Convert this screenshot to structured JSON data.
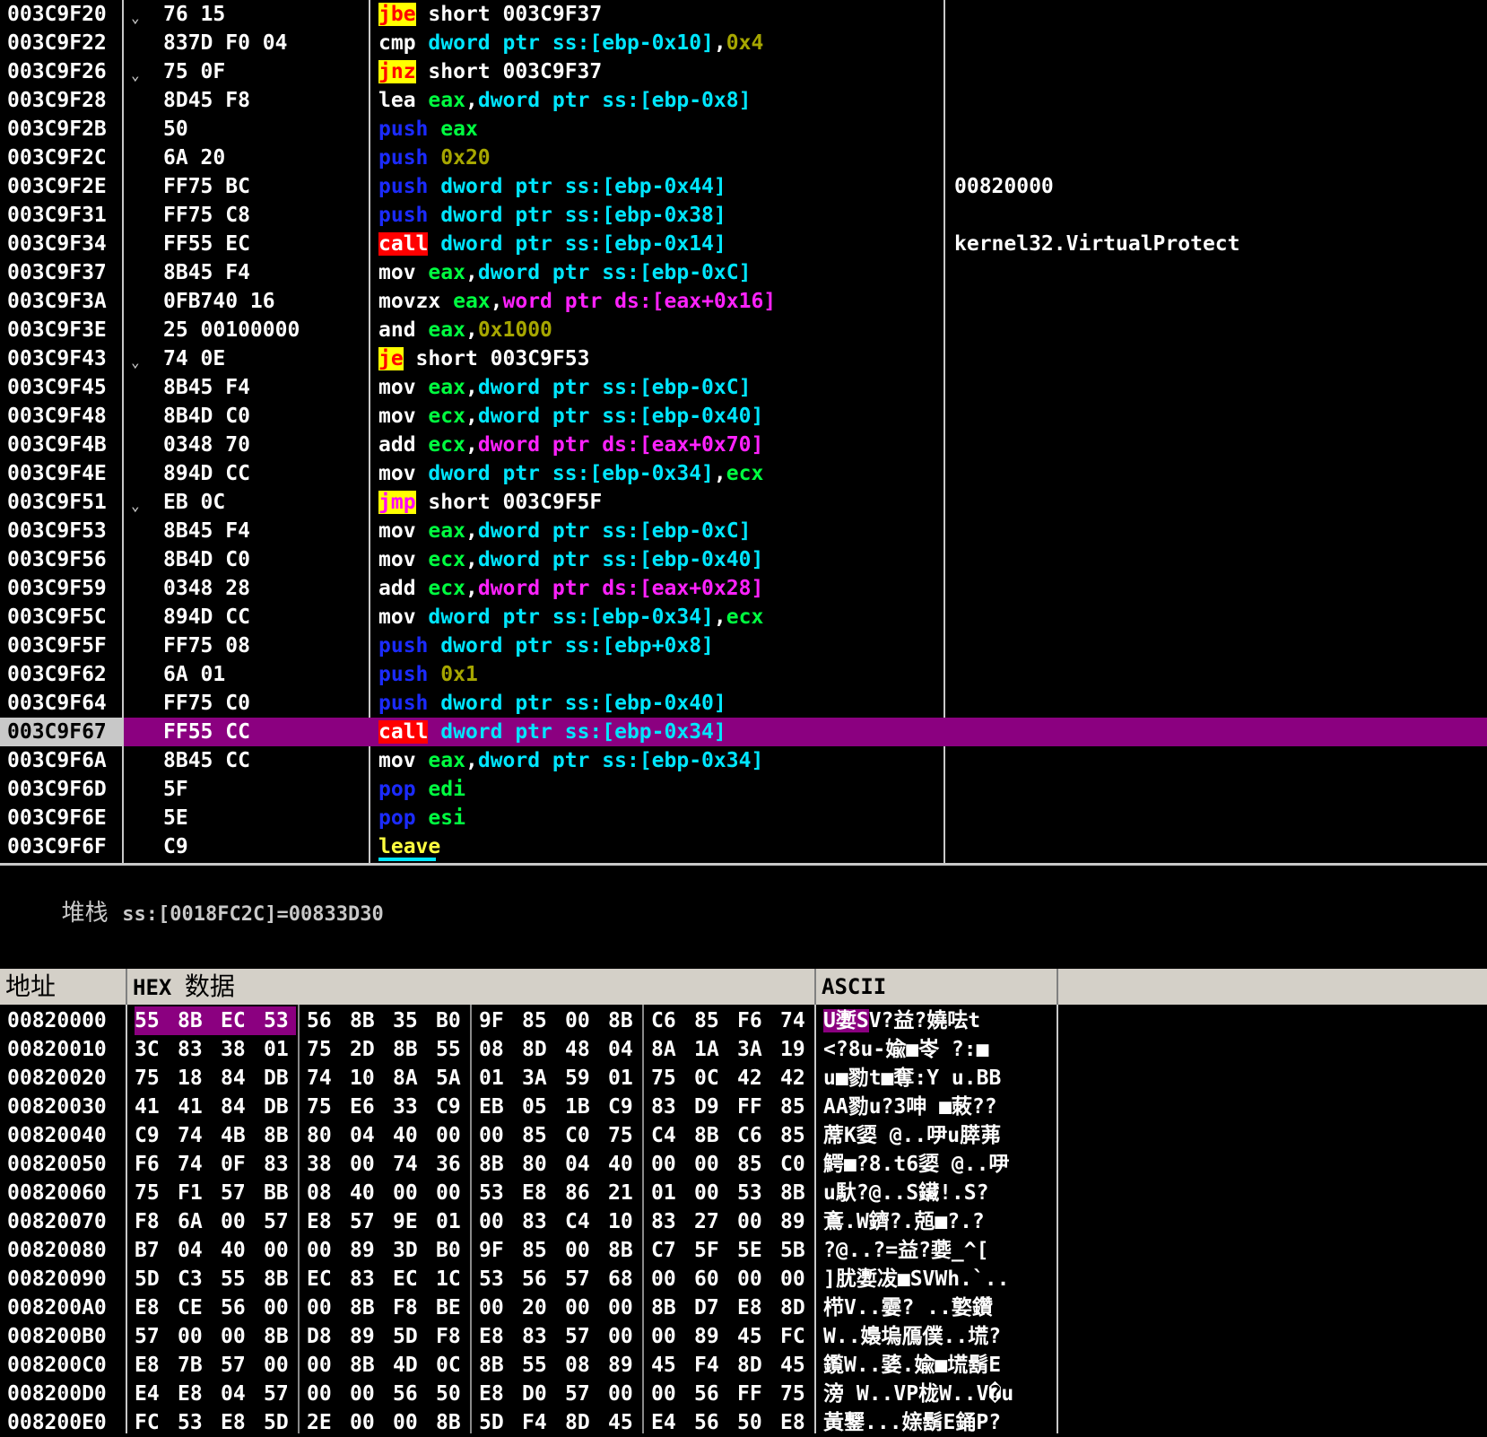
{
  "disasm": {
    "selected_index": 25,
    "rows": [
      {
        "addr": "003C9F20",
        "mark": "⌄",
        "hex": "76 15",
        "asm": [
          {
            "t": "jbe",
            "c": "m-jcc"
          },
          {
            "t": " short 003C9F37",
            "c": "wht"
          }
        ],
        "comment": ""
      },
      {
        "addr": "003C9F22",
        "mark": "",
        "hex": "837D F0 04",
        "asm": [
          {
            "t": "cmp",
            "c": "m-std"
          },
          {
            "t": " ",
            "c": "wht"
          },
          {
            "t": "dword ptr ss:[ebp-0x10]",
            "c": "mem"
          },
          {
            "t": ",",
            "c": "wht"
          },
          {
            "t": "0x4",
            "c": "imm"
          }
        ],
        "comment": ""
      },
      {
        "addr": "003C9F26",
        "mark": "⌄",
        "hex": "75 0F",
        "asm": [
          {
            "t": "jnz",
            "c": "m-jcc"
          },
          {
            "t": " short 003C9F37",
            "c": "wht"
          }
        ],
        "comment": ""
      },
      {
        "addr": "003C9F28",
        "mark": "",
        "hex": "8D45 F8",
        "asm": [
          {
            "t": "lea",
            "c": "m-std"
          },
          {
            "t": " ",
            "c": "wht"
          },
          {
            "t": "eax",
            "c": "reg"
          },
          {
            "t": ",",
            "c": "wht"
          },
          {
            "t": "dword ptr ss:[ebp-0x8]",
            "c": "mem"
          }
        ],
        "comment": ""
      },
      {
        "addr": "003C9F2B",
        "mark": "",
        "hex": "50",
        "asm": [
          {
            "t": "push",
            "c": "m-push"
          },
          {
            "t": " ",
            "c": "wht"
          },
          {
            "t": "eax",
            "c": "reg"
          }
        ],
        "comment": ""
      },
      {
        "addr": "003C9F2C",
        "mark": "",
        "hex": "6A 20",
        "asm": [
          {
            "t": "push",
            "c": "m-push"
          },
          {
            "t": " ",
            "c": "wht"
          },
          {
            "t": "0x20",
            "c": "imm"
          }
        ],
        "comment": ""
      },
      {
        "addr": "003C9F2E",
        "mark": "",
        "hex": "FF75 BC",
        "asm": [
          {
            "t": "push",
            "c": "m-push"
          },
          {
            "t": " ",
            "c": "wht"
          },
          {
            "t": "dword ptr ss:[ebp-0x44]",
            "c": "mem"
          }
        ],
        "comment": "00820000"
      },
      {
        "addr": "003C9F31",
        "mark": "",
        "hex": "FF75 C8",
        "asm": [
          {
            "t": "push",
            "c": "m-push"
          },
          {
            "t": " ",
            "c": "wht"
          },
          {
            "t": "dword ptr ss:[ebp-0x38]",
            "c": "mem"
          }
        ],
        "comment": ""
      },
      {
        "addr": "003C9F34",
        "mark": "",
        "hex": "FF55 EC",
        "asm": [
          {
            "t": "call",
            "c": "m-call"
          },
          {
            "t": " ",
            "c": "wht"
          },
          {
            "t": "dword ptr ss:[ebp-0x14]",
            "c": "mem"
          }
        ],
        "comment": "kernel32.VirtualProtect"
      },
      {
        "addr": "003C9F37",
        "mark": "",
        "hex": "8B45 F4",
        "asm": [
          {
            "t": "mov",
            "c": "m-std"
          },
          {
            "t": " ",
            "c": "wht"
          },
          {
            "t": "eax",
            "c": "reg"
          },
          {
            "t": ",",
            "c": "wht"
          },
          {
            "t": "dword ptr ss:[ebp-0xC]",
            "c": "mem"
          }
        ],
        "comment": ""
      },
      {
        "addr": "003C9F3A",
        "mark": "",
        "hex": "0FB740 16",
        "asm": [
          {
            "t": "movzx",
            "c": "m-std"
          },
          {
            "t": " ",
            "c": "wht"
          },
          {
            "t": "eax",
            "c": "reg"
          },
          {
            "t": ",",
            "c": "wht"
          },
          {
            "t": "word ptr ds:[eax+0x16]",
            "c": "memds"
          }
        ],
        "comment": ""
      },
      {
        "addr": "003C9F3E",
        "mark": "",
        "hex": "25 00100000",
        "asm": [
          {
            "t": "and",
            "c": "m-std"
          },
          {
            "t": " ",
            "c": "wht"
          },
          {
            "t": "eax",
            "c": "reg"
          },
          {
            "t": ",",
            "c": "wht"
          },
          {
            "t": "0x1000",
            "c": "imm"
          }
        ],
        "comment": ""
      },
      {
        "addr": "003C9F43",
        "mark": "⌄",
        "hex": "74 0E",
        "asm": [
          {
            "t": "je",
            "c": "m-jcc"
          },
          {
            "t": " short 003C9F53",
            "c": "wht"
          }
        ],
        "comment": ""
      },
      {
        "addr": "003C9F45",
        "mark": "",
        "hex": "8B45 F4",
        "asm": [
          {
            "t": "mov",
            "c": "m-std"
          },
          {
            "t": " ",
            "c": "wht"
          },
          {
            "t": "eax",
            "c": "reg"
          },
          {
            "t": ",",
            "c": "wht"
          },
          {
            "t": "dword ptr ss:[ebp-0xC]",
            "c": "mem"
          }
        ],
        "comment": ""
      },
      {
        "addr": "003C9F48",
        "mark": "",
        "hex": "8B4D C0",
        "asm": [
          {
            "t": "mov",
            "c": "m-std"
          },
          {
            "t": " ",
            "c": "wht"
          },
          {
            "t": "ecx",
            "c": "reg"
          },
          {
            "t": ",",
            "c": "wht"
          },
          {
            "t": "dword ptr ss:[ebp-0x40]",
            "c": "mem"
          }
        ],
        "comment": ""
      },
      {
        "addr": "003C9F4B",
        "mark": "",
        "hex": "0348 70",
        "asm": [
          {
            "t": "add",
            "c": "m-std"
          },
          {
            "t": " ",
            "c": "wht"
          },
          {
            "t": "ecx",
            "c": "reg"
          },
          {
            "t": ",",
            "c": "wht"
          },
          {
            "t": "dword ptr ds:[eax+0x70]",
            "c": "memds"
          }
        ],
        "comment": ""
      },
      {
        "addr": "003C9F4E",
        "mark": "",
        "hex": "894D CC",
        "asm": [
          {
            "t": "mov",
            "c": "m-std"
          },
          {
            "t": " ",
            "c": "wht"
          },
          {
            "t": "dword ptr ss:[ebp-0x34]",
            "c": "mem"
          },
          {
            "t": ",",
            "c": "wht"
          },
          {
            "t": "ecx",
            "c": "reg"
          }
        ],
        "comment": ""
      },
      {
        "addr": "003C9F51",
        "mark": "⌄",
        "hex": "EB 0C",
        "asm": [
          {
            "t": "jmp",
            "c": "m-jmp"
          },
          {
            "t": " short 003C9F5F",
            "c": "wht"
          }
        ],
        "comment": ""
      },
      {
        "addr": "003C9F53",
        "mark": "",
        "hex": "8B45 F4",
        "asm": [
          {
            "t": "mov",
            "c": "m-std"
          },
          {
            "t": " ",
            "c": "wht"
          },
          {
            "t": "eax",
            "c": "reg"
          },
          {
            "t": ",",
            "c": "wht"
          },
          {
            "t": "dword ptr ss:[ebp-0xC]",
            "c": "mem"
          }
        ],
        "comment": ""
      },
      {
        "addr": "003C9F56",
        "mark": "",
        "hex": "8B4D C0",
        "asm": [
          {
            "t": "mov",
            "c": "m-std"
          },
          {
            "t": " ",
            "c": "wht"
          },
          {
            "t": "ecx",
            "c": "reg"
          },
          {
            "t": ",",
            "c": "wht"
          },
          {
            "t": "dword ptr ss:[ebp-0x40]",
            "c": "mem"
          }
        ],
        "comment": ""
      },
      {
        "addr": "003C9F59",
        "mark": "",
        "hex": "0348 28",
        "asm": [
          {
            "t": "add",
            "c": "m-std"
          },
          {
            "t": " ",
            "c": "wht"
          },
          {
            "t": "ecx",
            "c": "reg"
          },
          {
            "t": ",",
            "c": "wht"
          },
          {
            "t": "dword ptr ds:[eax+0x28]",
            "c": "memds"
          }
        ],
        "comment": ""
      },
      {
        "addr": "003C9F5C",
        "mark": "",
        "hex": "894D CC",
        "asm": [
          {
            "t": "mov",
            "c": "m-std"
          },
          {
            "t": " ",
            "c": "wht"
          },
          {
            "t": "dword ptr ss:[ebp-0x34]",
            "c": "mem"
          },
          {
            "t": ",",
            "c": "wht"
          },
          {
            "t": "ecx",
            "c": "reg"
          }
        ],
        "comment": ""
      },
      {
        "addr": "003C9F5F",
        "mark": "",
        "hex": "FF75 08",
        "asm": [
          {
            "t": "push",
            "c": "m-push"
          },
          {
            "t": " ",
            "c": "wht"
          },
          {
            "t": "dword ptr ss:[ebp+0x8]",
            "c": "mem"
          }
        ],
        "comment": ""
      },
      {
        "addr": "003C9F62",
        "mark": "",
        "hex": "6A 01",
        "asm": [
          {
            "t": "push",
            "c": "m-push"
          },
          {
            "t": " ",
            "c": "wht"
          },
          {
            "t": "0x1",
            "c": "imm"
          }
        ],
        "comment": ""
      },
      {
        "addr": "003C9F64",
        "mark": "",
        "hex": "FF75 C0",
        "asm": [
          {
            "t": "push",
            "c": "m-push"
          },
          {
            "t": " ",
            "c": "wht"
          },
          {
            "t": "dword ptr ss:[ebp-0x40]",
            "c": "mem"
          }
        ],
        "comment": ""
      },
      {
        "addr": "003C9F67",
        "mark": "",
        "hex": "FF55 CC",
        "asm": [
          {
            "t": "call",
            "c": "m-call"
          },
          {
            "t": " ",
            "c": "wht"
          },
          {
            "t": "dword ptr ss:[ebp-0x34]",
            "c": "mem"
          }
        ],
        "comment": ""
      },
      {
        "addr": "003C9F6A",
        "mark": "",
        "hex": "8B45 CC",
        "asm": [
          {
            "t": "mov",
            "c": "m-std"
          },
          {
            "t": " ",
            "c": "wht"
          },
          {
            "t": "eax",
            "c": "reg"
          },
          {
            "t": ",",
            "c": "wht"
          },
          {
            "t": "dword ptr ss:[ebp-0x34]",
            "c": "mem"
          }
        ],
        "comment": ""
      },
      {
        "addr": "003C9F6D",
        "mark": "",
        "hex": "5F",
        "asm": [
          {
            "t": "pop",
            "c": "m-push"
          },
          {
            "t": " ",
            "c": "wht"
          },
          {
            "t": "edi",
            "c": "reg"
          }
        ],
        "comment": ""
      },
      {
        "addr": "003C9F6E",
        "mark": "",
        "hex": "5E",
        "asm": [
          {
            "t": "pop",
            "c": "m-push"
          },
          {
            "t": " ",
            "c": "wht"
          },
          {
            "t": "esi",
            "c": "reg"
          }
        ],
        "comment": ""
      },
      {
        "addr": "003C9F6F",
        "mark": "",
        "hex": "C9",
        "asm": [
          {
            "t": "leave",
            "c": "m-std-yellow"
          }
        ],
        "comment": ""
      }
    ]
  },
  "info": {
    "label": "堆栈",
    "value": "ss:[0018FC2C]=00833D30"
  },
  "dump": {
    "header": {
      "address": "地址",
      "hex_prefix": "HEX",
      "hex_cn": "数据",
      "ascii": "ASCII"
    },
    "rows": [
      {
        "addr": "00820000",
        "bytes": [
          "55",
          "8B",
          "EC",
          "53",
          "56",
          "8B",
          "35",
          "B0",
          "9F",
          "85",
          "00",
          "8B",
          "C6",
          "85",
          "F6",
          "74"
        ],
        "ascii": "U嬱SV?益?嬈呿t",
        "hl": [
          0,
          1,
          2,
          3
        ],
        "ascii_hl": 3
      },
      {
        "addr": "00820010",
        "bytes": [
          "3C",
          "83",
          "38",
          "01",
          "75",
          "2D",
          "8B",
          "55",
          "08",
          "8D",
          "48",
          "04",
          "8A",
          "1A",
          "3A",
          "19"
        ],
        "ascii": "<?8u-婾■岺 ?:■"
      },
      {
        "addr": "00820020",
        "bytes": [
          "75",
          "18",
          "84",
          "DB",
          "74",
          "10",
          "8A",
          "5A",
          "01",
          "3A",
          "59",
          "01",
          "75",
          "0C",
          "42",
          "42"
        ],
        "ascii": "u■勠t■奪:Y u.BB"
      },
      {
        "addr": "00820030",
        "bytes": [
          "41",
          "41",
          "84",
          "DB",
          "75",
          "E6",
          "33",
          "C9",
          "EB",
          "05",
          "1B",
          "C9",
          "83",
          "D9",
          "FF",
          "85"
        ],
        "ascii": "AA勠u?3呻 ■蓛??"
      },
      {
        "addr": "00820040",
        "bytes": [
          "C9",
          "74",
          "4B",
          "8B",
          "80",
          "04",
          "40",
          "00",
          "00",
          "85",
          "C0",
          "75",
          "C4",
          "8B",
          "C6",
          "85"
        ],
        "ascii": "蓆K媭 @..吚u膵茀"
      },
      {
        "addr": "00820050",
        "bytes": [
          "F6",
          "74",
          "0F",
          "83",
          "38",
          "00",
          "74",
          "36",
          "8B",
          "80",
          "04",
          "40",
          "00",
          "00",
          "85",
          "C0"
        ],
        "ascii": "鰐■?8.t6媭 @..吚"
      },
      {
        "addr": "00820060",
        "bytes": [
          "75",
          "F1",
          "57",
          "BB",
          "08",
          "40",
          "00",
          "00",
          "53",
          "E8",
          "86",
          "21",
          "01",
          "00",
          "53",
          "8B"
        ],
        "ascii": "u馱?@..S鑶!.S?"
      },
      {
        "addr": "00820070",
        "bytes": [
          "F8",
          "6A",
          "00",
          "57",
          "E8",
          "57",
          "9E",
          "01",
          "00",
          "83",
          "C4",
          "10",
          "83",
          "27",
          "00",
          "89"
        ],
        "ascii": "鴍.W鑇?.兡■?.?"
      },
      {
        "addr": "00820080",
        "bytes": [
          "B7",
          "04",
          "40",
          "00",
          "00",
          "89",
          "3D",
          "B0",
          "9F",
          "85",
          "00",
          "8B",
          "C7",
          "5F",
          "5E",
          "5B"
        ],
        "ascii": "?@..?=益?嬊_^["
      },
      {
        "addr": "00820090",
        "bytes": [
          "5D",
          "C3",
          "55",
          "8B",
          "EC",
          "83",
          "EC",
          "1C",
          "53",
          "56",
          "57",
          "68",
          "00",
          "60",
          "00",
          "00"
        ],
        "ascii": "]肬嬱冹■SVWh.`.."
      },
      {
        "addr": "008200A0",
        "bytes": [
          "E8",
          "CE",
          "56",
          "00",
          "00",
          "8B",
          "F8",
          "BE",
          "00",
          "20",
          "00",
          "00",
          "8B",
          "D7",
          "E8",
          "8D"
        ],
        "ascii": "栉V..孁? ..嬜鑽"
      },
      {
        "addr": "008200B0",
        "bytes": [
          "57",
          "00",
          "00",
          "8B",
          "D8",
          "89",
          "5D",
          "F8",
          "E8",
          "83",
          "57",
          "00",
          "00",
          "89",
          "45",
          "FC"
        ],
        "ascii": "W..嬝塢鴈僕..塃?"
      },
      {
        "addr": "008200C0",
        "bytes": [
          "E8",
          "7B",
          "57",
          "00",
          "00",
          "8B",
          "4D",
          "0C",
          "8B",
          "55",
          "08",
          "89",
          "45",
          "F4",
          "8D",
          "45"
        ],
        "ascii": "鑬W..婱.婾■塃鬍E"
      },
      {
        "addr": "008200D0",
        "bytes": [
          "E4",
          "E8",
          "04",
          "57",
          "00",
          "00",
          "56",
          "50",
          "E8",
          "D0",
          "57",
          "00",
          "00",
          "56",
          "FF",
          "75"
        ],
        "ascii": "滂 W..VP栊W..V�u"
      },
      {
        "addr": "008200E0",
        "bytes": [
          "FC",
          "53",
          "E8",
          "5D",
          "2E",
          "00",
          "00",
          "8B",
          "5D",
          "F4",
          "8D",
          "45",
          "E4",
          "56",
          "50",
          "E8"
        ],
        "ascii": "黃鑋...媇鬍E銿P?"
      }
    ]
  },
  "colors": {
    "background": "#000000",
    "selection": "#8b0080",
    "push_pop": "#1b2bff",
    "register": "#00ff40",
    "memory_ss": "#00e6ff",
    "memory_ds": "#ff22ff",
    "immediate": "#a6a600",
    "jcc_bg": "#ffff00",
    "call_bg": "#ff0000"
  }
}
